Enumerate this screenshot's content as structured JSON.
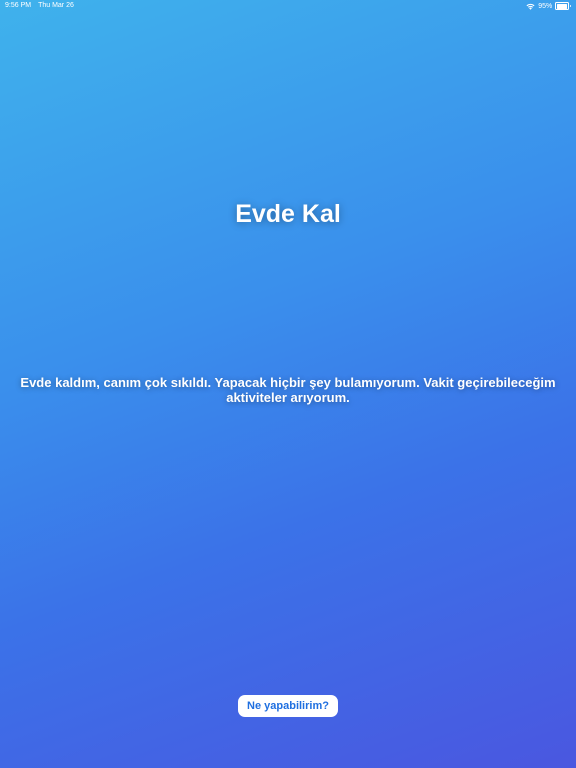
{
  "status_bar": {
    "time": "9:56 PM",
    "date": "Thu Mar 26",
    "battery_text": "95%",
    "battery_level": 0.95,
    "icons": [
      "wifi-icon",
      "battery-icon"
    ]
  },
  "main": {
    "title": "Evde Kal",
    "description": "Evde kaldım, canım çok sıkıldı. Yapacak hiçbir şey bulamıyorum. Vakit geçirebileceğim aktiviteler arıyorum.",
    "action_label": "Ne yapabilirim?"
  },
  "colors": {
    "gradient_start": "#3fb2ec",
    "gradient_end": "#4a57e0",
    "button_text": "#1f6fe0",
    "button_bg": "#ffffff"
  }
}
